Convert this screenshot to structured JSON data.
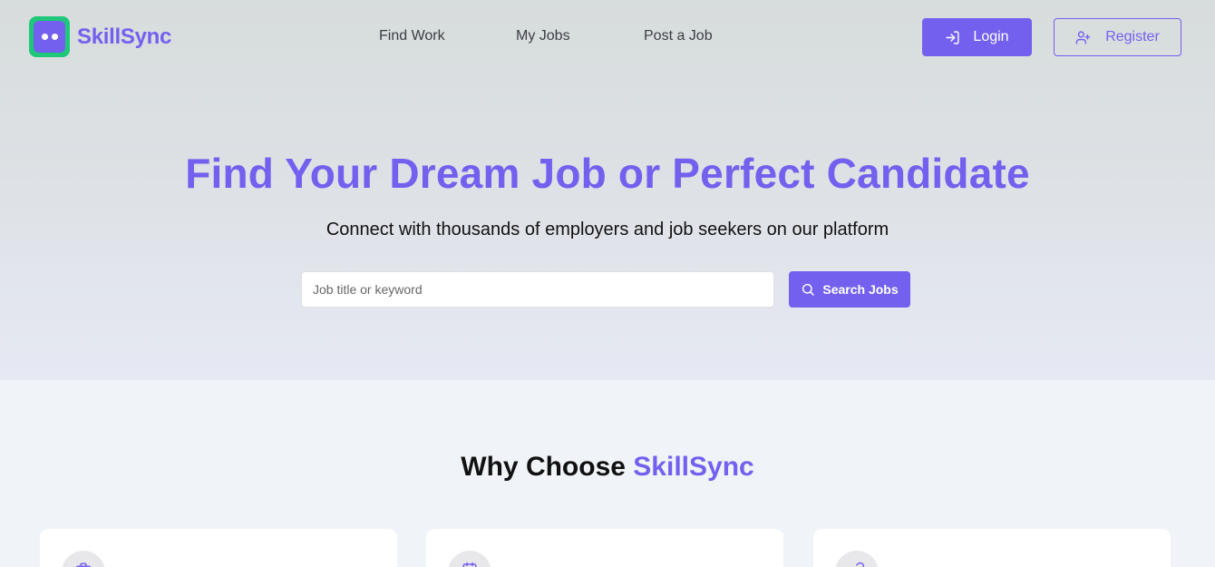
{
  "header": {
    "brand": "SkillSync",
    "nav": [
      "Find Work",
      "My Jobs",
      "Post a Job"
    ],
    "login_label": "Login",
    "register_label": "Register"
  },
  "hero": {
    "title": "Find Your Dream Job or Perfect Candidate",
    "subtitle": "Connect with thousands of employers and job seekers on our platform",
    "search_placeholder": "Job title or keyword",
    "search_value": "",
    "search_button": "Search Jobs"
  },
  "why": {
    "prefix": "Why Choose",
    "brand": "SkillSync"
  },
  "features": [
    {
      "icon": "briefcase-icon"
    },
    {
      "icon": "calendar-icon"
    },
    {
      "icon": "link-icon"
    }
  ],
  "colors": {
    "accent": "#7460ee",
    "logo_green": "#1ec77a"
  }
}
